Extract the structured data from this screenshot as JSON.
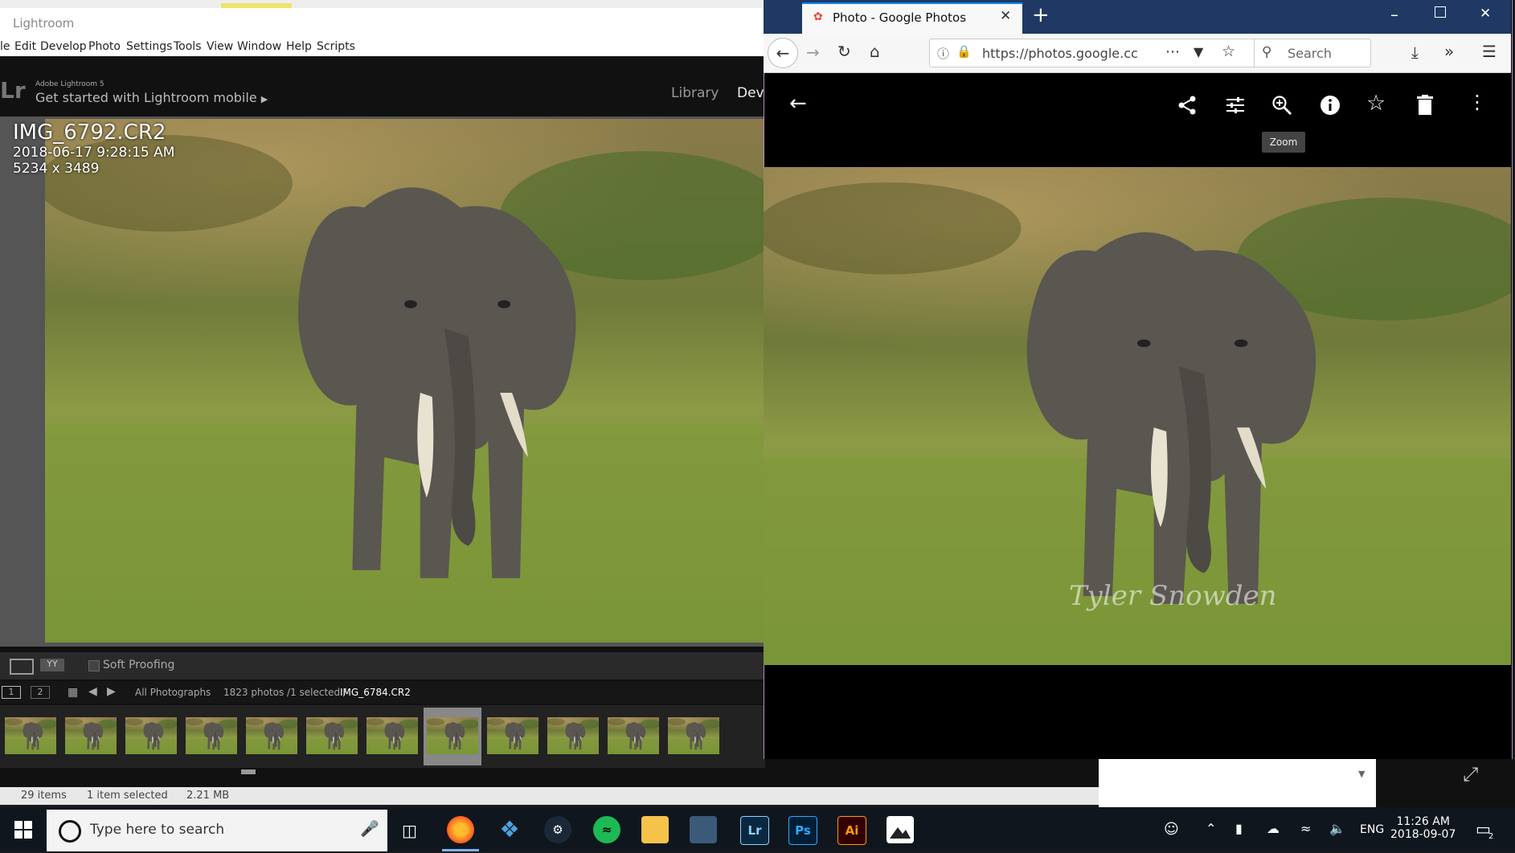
{
  "lightroom": {
    "window_title": "Lightroom",
    "menu": [
      "le",
      "Edit",
      "Develop",
      "Photo",
      "Settings",
      "Tools",
      "View",
      "Window",
      "Help",
      "Scripts"
    ],
    "logo": "Lr",
    "product": "Adobe Lightroom 5",
    "mobile_link": "Get started with Lightroom mobile",
    "modules": {
      "library": "Library",
      "develop": "Dev"
    },
    "photo_info": {
      "name": "IMG_6792.CR2",
      "date": "2018-06-17 9:28:15 AM",
      "dims": "5234 x 3489"
    },
    "toolbar": {
      "soft_proofing": "Soft Proofing"
    },
    "filmbar": {
      "screen1": "1",
      "screen2": "2",
      "source": "All Photographs",
      "count": "1823 photos /1 selected /",
      "filename": "IMG_6784.CR2"
    },
    "statusbar": {
      "items": "29 items",
      "selected": "1 item selected",
      "size": "2.21 MB"
    }
  },
  "firefox": {
    "tab_title": "Photo - Google Photos",
    "url": "https://photos.google.cc",
    "search_placeholder": "Search",
    "tooltip": "Zoom",
    "watermark": "Tyler Snowden"
  },
  "taskbar": {
    "search_placeholder": "Type here to search",
    "apps": [
      "firefox",
      "kodi",
      "steam",
      "spotify",
      "file-explorer",
      "this-pc",
      "Lr",
      "Ps",
      "Ai",
      "photos"
    ],
    "lang": "ENG",
    "time": "11:26 AM",
    "date": "2018-09-07",
    "notifications": "2"
  }
}
